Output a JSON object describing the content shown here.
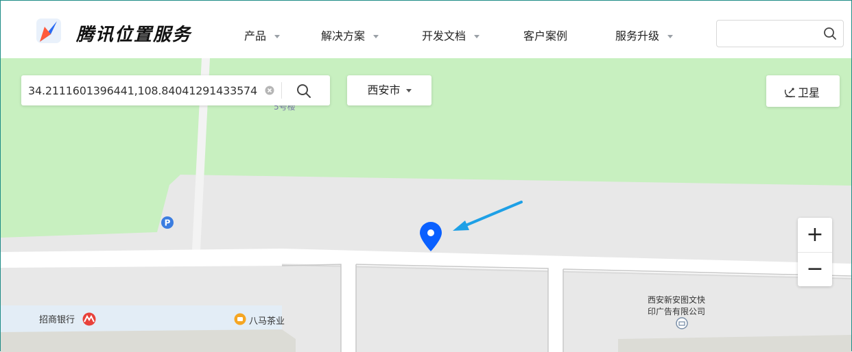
{
  "header": {
    "brand": "腾讯位置服务",
    "nav": [
      {
        "label": "产品",
        "dropdown": true
      },
      {
        "label": "解决方案",
        "dropdown": true
      },
      {
        "label": "开发文档",
        "dropdown": true
      },
      {
        "label": "客户案例",
        "dropdown": false
      },
      {
        "label": "服务升级",
        "dropdown": true
      }
    ],
    "search": {
      "value": "",
      "placeholder": "",
      "icon": "search-icon"
    }
  },
  "map": {
    "coord_search": {
      "value": "34.2111601396441,108.84041291433574",
      "clear_icon": "clear-icon",
      "search_icon": "search-icon"
    },
    "city_selector": {
      "label": "西安市",
      "icon": "caret-down-icon"
    },
    "satellite_toggle": {
      "label": "卫星",
      "icon": "satellite-icon"
    },
    "zoom": {
      "in_label": "+",
      "out_label": "−"
    },
    "labels": {
      "building_partial": "5号楼",
      "bank": "招商银行",
      "tea": "八马茶业",
      "print_line1": "西安新安图文快",
      "print_line2": "印广告有限公司"
    },
    "colors": {
      "green_area": "#c8f0c0",
      "road": "#ffffff",
      "ground": "#e8e8e8",
      "marker": "#0a60ff",
      "arrow": "#1ea0e6"
    }
  }
}
